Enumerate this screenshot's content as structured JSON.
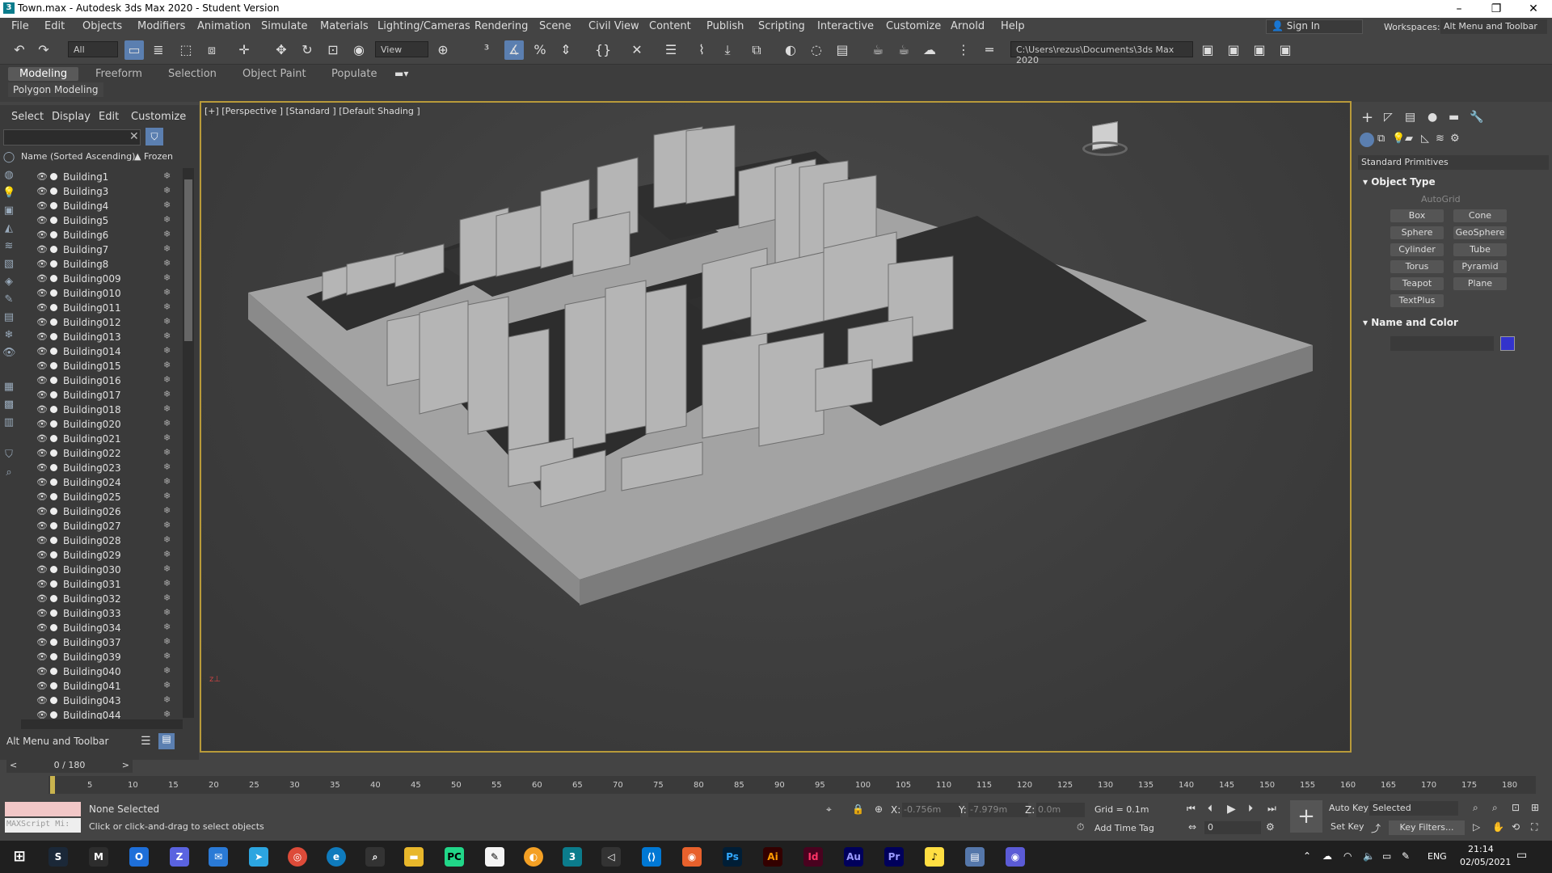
{
  "window": {
    "title": "Town.max - Autodesk 3ds Max 2020 - Student Version",
    "app_icon": "3"
  },
  "menu": [
    "File",
    "Edit",
    "Objects",
    "Modifiers",
    "Animation",
    "Simulate",
    "Materials",
    "Lighting/Cameras",
    "Rendering",
    "Scene",
    "Civil View",
    "Content",
    "Publish",
    "Scripting",
    "Interactive",
    "Customize",
    "Arnold",
    "Help"
  ],
  "signin": "Sign In",
  "workspaces_label": "Workspaces:",
  "workspace_value": "Alt Menu and Toolbar",
  "toolbar": {
    "filter": "All",
    "refcoord": "View",
    "path": "C:\\Users\\rezus\\Documents\\3ds Max 2020"
  },
  "ribbon": {
    "tabs": [
      "Modeling",
      "Freeform",
      "Selection",
      "Object Paint",
      "Populate"
    ],
    "panel": "Polygon Modeling"
  },
  "explorer": {
    "tabs": [
      "Select",
      "Display",
      "Edit",
      "Customize"
    ],
    "col_name": "Name (Sorted Ascending)",
    "col_frozen": "▲ Frozen",
    "sort_arrow": "▲",
    "items": [
      "Building1",
      "Building3",
      "Building4",
      "Building5",
      "Building6",
      "Building7",
      "Building8",
      "Building009",
      "Building010",
      "Building011",
      "Building012",
      "Building013",
      "Building014",
      "Building015",
      "Building016",
      "Building017",
      "Building018",
      "Building020",
      "Building021",
      "Building022",
      "Building023",
      "Building024",
      "Building025",
      "Building026",
      "Building027",
      "Building028",
      "Building029",
      "Building030",
      "Building031",
      "Building032",
      "Building033",
      "Building034",
      "Building037",
      "Building039",
      "Building040",
      "Building041",
      "Building043",
      "Building044"
    ],
    "layer_dropdown": "Alt Menu and Toolbar"
  },
  "viewport": {
    "label": "[+] [Perspective ] [Standard ] [Default Shading ]"
  },
  "command_panel": {
    "dropdown": "Standard Primitives",
    "object_type": "Object Type",
    "autogrid": "AutoGrid",
    "buttons": [
      "Box",
      "Cone",
      "Sphere",
      "GeoSphere",
      "Cylinder",
      "Tube",
      "Torus",
      "Pyramid",
      "Teapot",
      "Plane",
      "TextPlus"
    ],
    "name_color": "Name and Color",
    "swatch": "#3333cc"
  },
  "timeline": {
    "frame": "0 / 180",
    "ticks": [
      "5",
      "10",
      "15",
      "20",
      "25",
      "30",
      "35",
      "40",
      "45",
      "50",
      "55",
      "60",
      "65",
      "70",
      "75",
      "80",
      "85",
      "90",
      "95",
      "100",
      "105",
      "110",
      "115",
      "120",
      "125",
      "130",
      "135",
      "140",
      "145",
      "150",
      "155",
      "160",
      "165",
      "170",
      "175",
      "180"
    ]
  },
  "status": {
    "selected": "None Selected",
    "hint": "Click or click-and-drag to select objects",
    "maxscript": "MAXScript Mi:",
    "x_label": "X:",
    "x": "-0.756m",
    "y_label": "Y:",
    "y": "-7.979m",
    "z_label": "Z:",
    "z": "0.0m",
    "grid": "Grid = 0.1m",
    "add_time_tag": "Add Time Tag",
    "auto_key": "Auto Key",
    "set_key": "Set Key",
    "selected_dd": "Selected",
    "key_filters": "Key Filters...",
    "frame_field": "0"
  },
  "tray": {
    "lang": "ENG",
    "time": "21:14",
    "date": "02/05/2021"
  }
}
